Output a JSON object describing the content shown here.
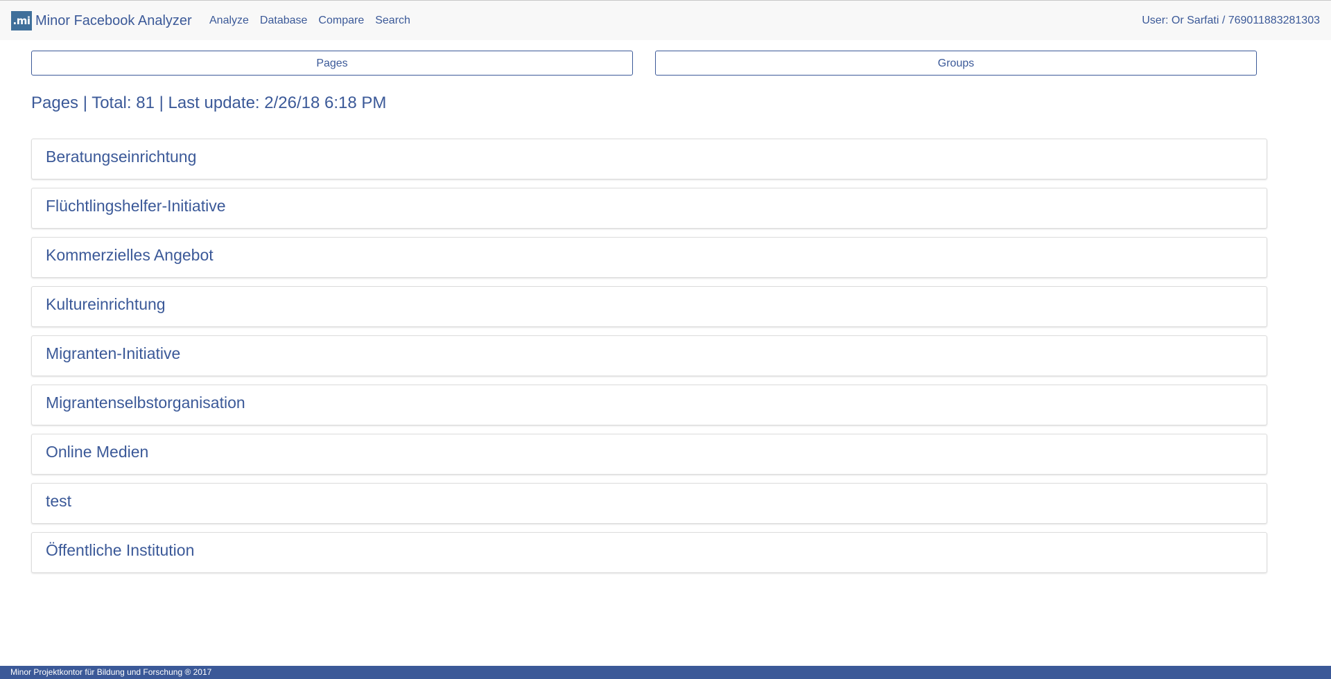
{
  "navbar": {
    "logo_text": ".mi",
    "brand": "Minor Facebook Analyzer",
    "links": [
      "Analyze",
      "Database",
      "Compare",
      "Search"
    ],
    "user": "User: Or Sarfati / 769011883281303"
  },
  "toggle": {
    "pages_label": "Pages",
    "groups_label": "Groups"
  },
  "summary": "Pages | Total: 81 | Last update: 2/26/18 6:18 PM",
  "categories": [
    "Beratungseinrichtung",
    "Flüchtlingshelfer-Initiative",
    "Kommerzielles Angebot",
    "Kultureinrichtung",
    "Migranten-Initiative",
    "Migrantenselbstorganisation",
    "Online Medien",
    "test",
    "Öffentliche Institution"
  ],
  "footer": "Minor Projektkontor für Bildung und Forschung ® 2017",
  "colors": {
    "accent": "#3b5998",
    "navbar_bg": "#f8f8f8",
    "logo_bg": "#3f6f9a"
  }
}
